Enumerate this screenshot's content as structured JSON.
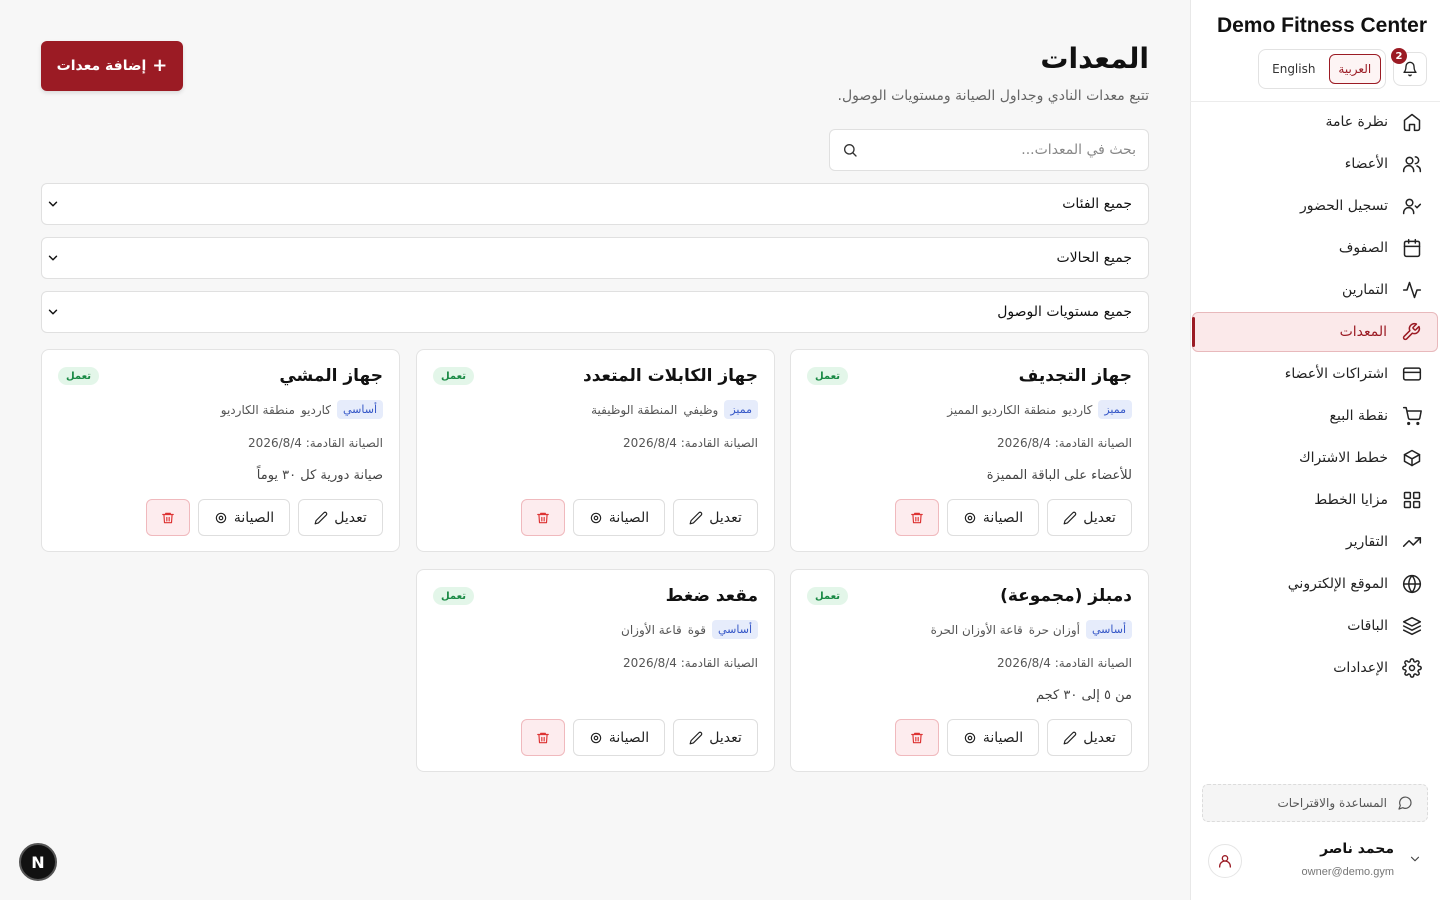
{
  "brand": "Demo Fitness Center",
  "lang": {
    "english": "English",
    "arabic": "العربية"
  },
  "notifications": {
    "count": "2"
  },
  "nav": [
    {
      "label": "نظرة عامة",
      "icon": "home-icon"
    },
    {
      "label": "الأعضاء",
      "icon": "users-icon"
    },
    {
      "label": "تسجيل الحضور",
      "icon": "user-check-icon"
    },
    {
      "label": "الصفوف",
      "icon": "calendar-icon"
    },
    {
      "label": "التمارين",
      "icon": "activity-icon"
    },
    {
      "label": "المعدات",
      "icon": "wrench-icon",
      "active": true
    },
    {
      "label": "اشتراكات الأعضاء",
      "icon": "credit-card-icon"
    },
    {
      "label": "نقطة البيع",
      "icon": "cart-icon"
    },
    {
      "label": "خطط الاشتراك",
      "icon": "package-icon"
    },
    {
      "label": "مزايا الخطط",
      "icon": "grid-icon"
    },
    {
      "label": "التقارير",
      "icon": "trending-up-icon"
    },
    {
      "label": "الموقع الإلكتروني",
      "icon": "globe-icon"
    },
    {
      "label": "الباقات",
      "icon": "layers-icon"
    },
    {
      "label": "الإعدادات",
      "icon": "gear-icon"
    }
  ],
  "help": "المساعدة والاقتراحات",
  "user": {
    "name": "محمد ناصر",
    "email": "owner@demo.gym"
  },
  "page": {
    "title": "المعدات",
    "subtitle": "تتبع معدات النادي وجداول الصيانة ومستويات الوصول.",
    "add_button": "إضافة معدات",
    "search_placeholder": "بحث في المعدات...",
    "filters": {
      "category": "جميع الفئات",
      "status": "جميع الحالات",
      "access": "جميع مستويات الوصول"
    }
  },
  "labels": {
    "edit": "تعديل",
    "maintenance": "الصيانة"
  },
  "equipment": [
    {
      "name": "جهاز التجديف",
      "status": "تعمل",
      "tier": "مميز",
      "category": "كارديو",
      "location": "منطقة الكارديو المميز",
      "next": "الصيانة القادمة: 2026/8/4",
      "notes": "للأعضاء على الباقة المميزة"
    },
    {
      "name": "جهاز الكابلات المتعدد",
      "status": "تعمل",
      "tier": "مميز",
      "category": "وظيفي",
      "location": "المنطقة الوظيفية",
      "next": "الصيانة القادمة: 2026/8/4",
      "notes": ""
    },
    {
      "name": "جهاز المشي",
      "status": "تعمل",
      "tier": "أساسي",
      "category": "كارديو",
      "location": "منطقة الكارديو",
      "next": "الصيانة القادمة: 2026/8/4",
      "notes": "صيانة دورية كل ٣٠ يوماً"
    },
    {
      "name": "دمبلز (مجموعة)",
      "status": "تعمل",
      "tier": "أساسي",
      "category": "أوزان حرة",
      "location": "قاعة الأوزان الحرة",
      "next": "الصيانة القادمة: 2026/8/4",
      "notes": "من ٥ إلى ٣٠ كجم"
    },
    {
      "name": "مقعد ضغط",
      "status": "تعمل",
      "tier": "أساسي",
      "category": "قوة",
      "location": "قاعة الأوزان",
      "next": "الصيانة القادمة: 2026/8/4",
      "notes": ""
    }
  ],
  "colors": {
    "accent": "#9b1b24",
    "status_green": "#1a8a45",
    "tier_blue": "#3557c7"
  }
}
